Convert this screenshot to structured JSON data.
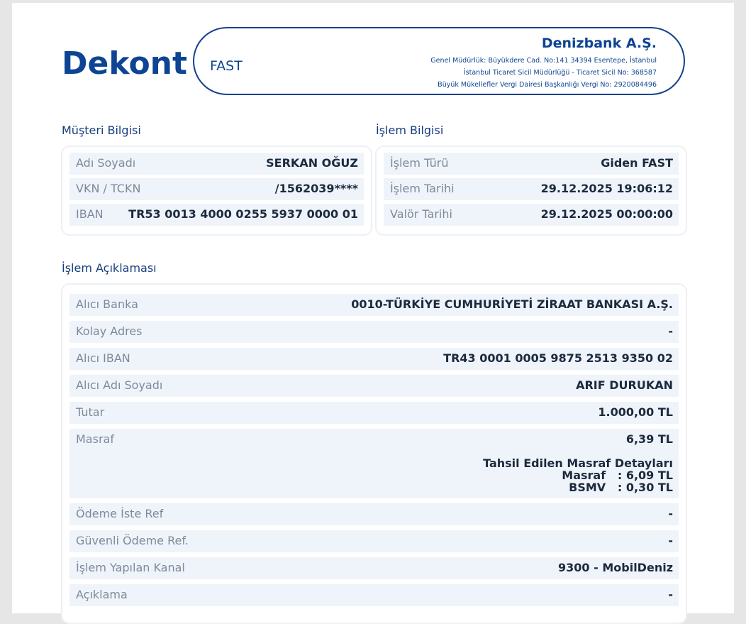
{
  "document": {
    "title": "Dekont"
  },
  "header": {
    "service": "FAST",
    "bank_name": "Denizbank A.Ş.",
    "address_line": "Genel Müdürlük: Büyükdere Cad. No:141 34394 Esentepe, İstanbul",
    "registry_line": "İstanbul Ticaret Sicil Müdürlüğü - Ticaret Sicil No: 368587",
    "tax_line": "Büyük Mükellefler Vergi Dairesi Başkanlığı Vergi No: 2920084496"
  },
  "customer": {
    "section_title": "Müşteri Bilgisi",
    "rows": [
      {
        "label": "Adı Soyadı",
        "value": "SERKAN OĞUZ"
      },
      {
        "label": "VKN / TCKN",
        "value": "/1562039****"
      },
      {
        "label": "IBAN",
        "value": "TR53 0013 4000 0255 5937 0000 01"
      }
    ]
  },
  "transaction": {
    "section_title": "İşlem Bilgisi",
    "rows": [
      {
        "label": "İşlem Türü",
        "value": "Giden FAST"
      },
      {
        "label": "İşlem Tarihi",
        "value": "29.12.2025 19:06:12"
      },
      {
        "label": "Valör Tarihi",
        "value": "29.12.2025 00:00:00"
      }
    ]
  },
  "description": {
    "section_title": "İşlem Açıklaması",
    "rows": [
      {
        "label": "Alıcı Banka",
        "value": "0010-TÜRKİYE CUMHURİYETİ ZİRAAT BANKASI A.Ş."
      },
      {
        "label": "Kolay Adres",
        "value": "-"
      },
      {
        "label": "Alıcı IBAN",
        "value": "TR43 0001 0005 9875 2513 9350 02"
      },
      {
        "label": "Alıcı Adı Soyadı",
        "value": "ARIF DURUKAN"
      },
      {
        "label": "Tutar",
        "value": "1.000,00 TL"
      },
      {
        "label": "Masraf",
        "value": "6,39 TL"
      },
      {
        "label": "Ödeme İste Ref",
        "value": "-"
      },
      {
        "label": "Güvenli Ödeme Ref.",
        "value": "-"
      },
      {
        "label": "İşlem Yapılan Kanal",
        "value": "9300 - MobilDeniz"
      },
      {
        "label": "Açıklama",
        "value": "-"
      }
    ],
    "fee_details": {
      "title": "Tahsil Edilen Masraf Detayları",
      "line1": "Masraf   : 6,09 TL",
      "line2": "BSMV   : 0,30 TL"
    }
  }
}
